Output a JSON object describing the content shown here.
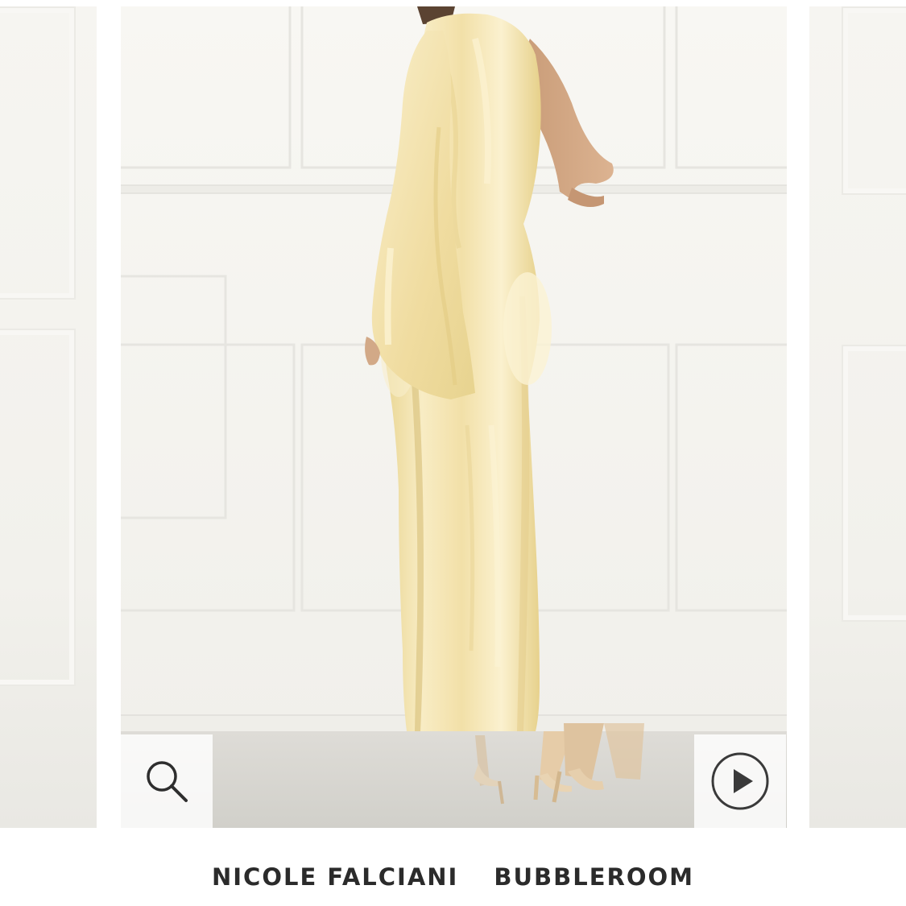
{
  "product": {
    "brand": "NICOLE FALCIANI",
    "retailer": "BUBBLEROOM",
    "image_alt": "Champagne satin one-shoulder maxi dress with flared sleeve"
  },
  "controls": {
    "zoom_icon": "magnifier-icon",
    "play_icon": "play-circle-icon"
  },
  "colors": {
    "dress": "#f0dfa4",
    "background": "#f4f3ef",
    "text": "#2b2b2b"
  }
}
